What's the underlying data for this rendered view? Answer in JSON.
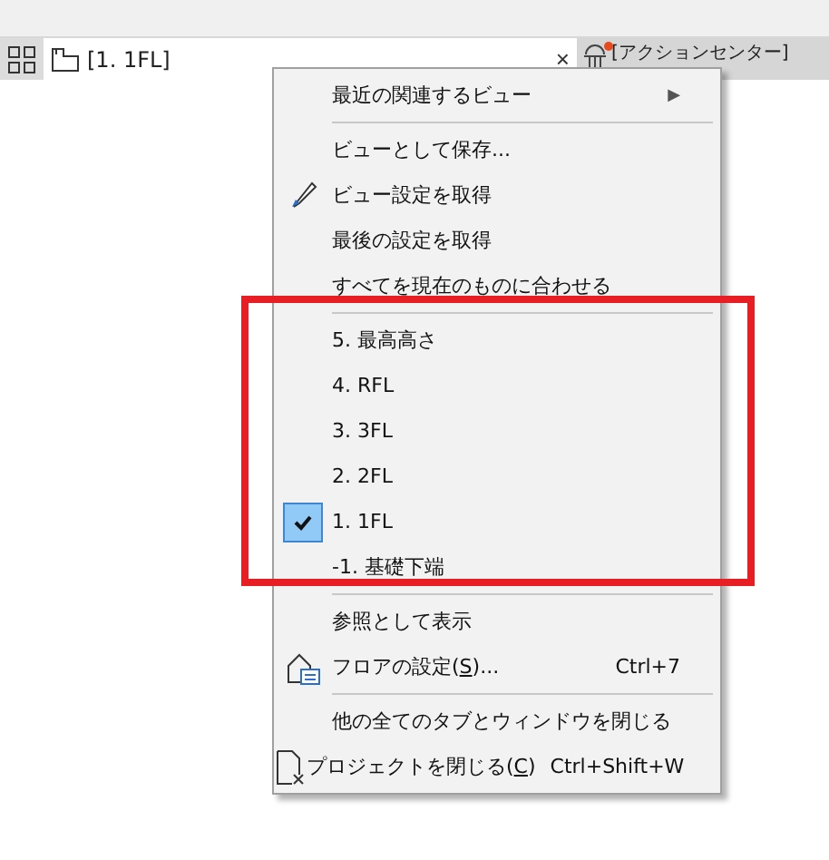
{
  "tab_bar": {
    "active_tab": {
      "label": "[1. 1FL]",
      "close": "×"
    },
    "other_tab": {
      "label": "[アクションセンター]",
      "notification": true
    }
  },
  "context_menu": {
    "items": [
      {
        "kind": "submenu",
        "label": "最近の関連するビュー",
        "arrow": "▶"
      },
      {
        "kind": "separator"
      },
      {
        "kind": "item",
        "label": "ビューとして保存..."
      },
      {
        "kind": "item",
        "label": "ビュー設定を取得"
      },
      {
        "kind": "item",
        "label": "最後の設定を取得"
      },
      {
        "kind": "item",
        "label": "すべてを現在のものに合わせる"
      },
      {
        "kind": "separator"
      },
      {
        "kind": "floor",
        "label": "5. 最高高さ",
        "checked": false
      },
      {
        "kind": "floor",
        "label": "4. RFL",
        "checked": false
      },
      {
        "kind": "floor",
        "label": "3. 3FL",
        "checked": false
      },
      {
        "kind": "floor",
        "label": "2. 2FL",
        "checked": false
      },
      {
        "kind": "floor",
        "label": "1. 1FL",
        "checked": true
      },
      {
        "kind": "floor",
        "label": "-1. 基礎下端",
        "checked": false
      },
      {
        "kind": "separator"
      },
      {
        "kind": "item",
        "label": "参照として表示"
      },
      {
        "kind": "item",
        "label": "フロアの設定(",
        "mnemonic": "S",
        "label_after": ")...",
        "shortcut": "Ctrl+7"
      },
      {
        "kind": "separator"
      },
      {
        "kind": "item",
        "label": "他の全てのタブとウィンドウを閉じる"
      },
      {
        "kind": "item",
        "label": "プロジェクトを閉じる(",
        "mnemonic": "C",
        "label_after": ")",
        "shortcut": "Ctrl+Shift+W"
      }
    ]
  },
  "annotation": {
    "kind": "highlight-frame",
    "color": "#e81e25"
  }
}
